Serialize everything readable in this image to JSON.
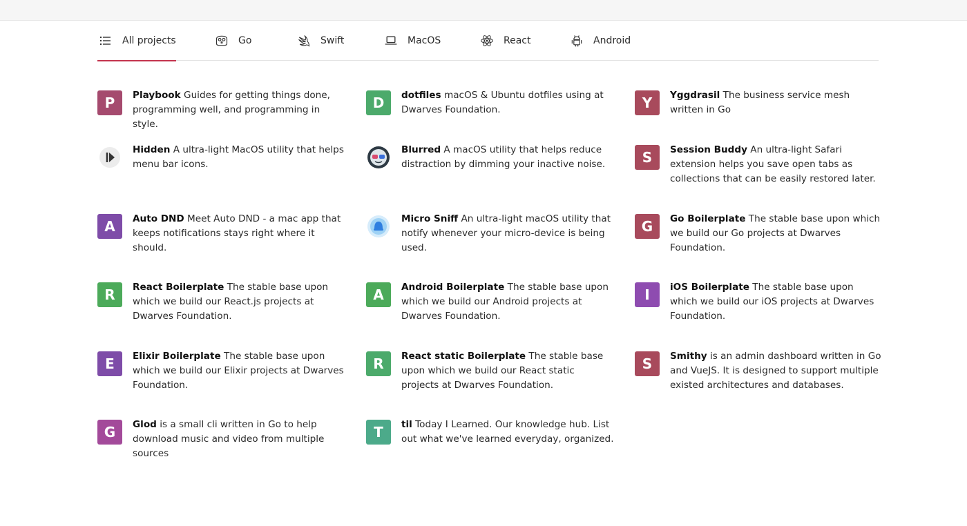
{
  "tabs": [
    {
      "label": "All projects",
      "icon": "list-icon",
      "active": true
    },
    {
      "label": "Go",
      "icon": "gopher-icon"
    },
    {
      "label": "Swift",
      "icon": "swift-icon"
    },
    {
      "label": "MacOS",
      "icon": "laptop-icon"
    },
    {
      "label": "React",
      "icon": "react-icon"
    },
    {
      "label": "Android",
      "icon": "android-icon"
    }
  ],
  "colors": {
    "accent": "#c4344e"
  },
  "projects": [
    {
      "letter": "P",
      "color": "#a54a6e",
      "name": "Playbook",
      "desc": "Guides for getting things done, programming well, and programming in style."
    },
    {
      "letter": "D",
      "color": "#4caa6b",
      "name": "dotfiles",
      "desc": "macOS & Ubuntu dotfiles using at Dwarves Foundation."
    },
    {
      "letter": "Y",
      "color": "#a84a5c",
      "name": "Yggdrasil",
      "desc": "The business service mesh written in Go"
    },
    {
      "logo": "hidden-logo",
      "name": "Hidden",
      "desc": "A ultra-light MacOS utility that helps menu bar icons."
    },
    {
      "logo": "blurred-logo",
      "name": "Blurred",
      "desc": "A macOS utility that helps reduce distraction by dimming your inactive noise."
    },
    {
      "letter": "S",
      "color": "#a84a5c",
      "name": "Session Buddy",
      "desc": "An ultra-light Safari extension helps you save open tabs as collections that can be easily restored later."
    },
    {
      "letter": "A",
      "color": "#7e4ca8",
      "name": "Auto DND",
      "desc": "Meet Auto DND - a mac app that keeps notifications stays right where it should."
    },
    {
      "logo": "micro-sniff-logo",
      "name": "Micro Sniff",
      "desc": "An ultra-light macOS utility that notify whenever your micro-device is being used."
    },
    {
      "letter": "G",
      "color": "#a84a5c",
      "name": "Go Boilerplate",
      "desc": "The stable base upon which we build our Go projects at Dwarves Foundation."
    },
    {
      "letter": "R",
      "color": "#4caa5a",
      "name": "React Boilerplate",
      "desc": "The stable base upon which we build our React.js projects at Dwarves Foundation."
    },
    {
      "letter": "A",
      "color": "#4caa5a",
      "name": "Android Boilerplate",
      "desc": "The stable base upon which we build our Android projects at Dwarves Foundation."
    },
    {
      "letter": "I",
      "color": "#8e4cb0",
      "name": "iOS Boilerplate",
      "desc": "The stable base upon which we build our iOS projects at Dwarves Foundation."
    },
    {
      "letter": "E",
      "color": "#7e4ca8",
      "name": "Elixir Boilerplate",
      "desc": "The stable base upon which we build our Elixir projects at Dwarves Foundation."
    },
    {
      "letter": "R",
      "color": "#4caa6b",
      "name": "React static Boilerplate",
      "desc": "The stable base upon which we build our React static projects at Dwarves Foundation."
    },
    {
      "letter": "S",
      "color": "#a84a5c",
      "name": "Smithy",
      "desc": "is an admin dashboard written in Go and VueJS. It is designed to support multiple existed architectures and databases."
    },
    {
      "letter": "G",
      "color": "#a34a9a",
      "name": "Glod",
      "desc": "is a small cli written in Go to help download music and video from multiple sources"
    },
    {
      "letter": "T",
      "color": "#4caa8a",
      "name": "til",
      "desc": "Today I Learned. Our knowledge hub. List out what we've learned everyday, organized."
    }
  ]
}
